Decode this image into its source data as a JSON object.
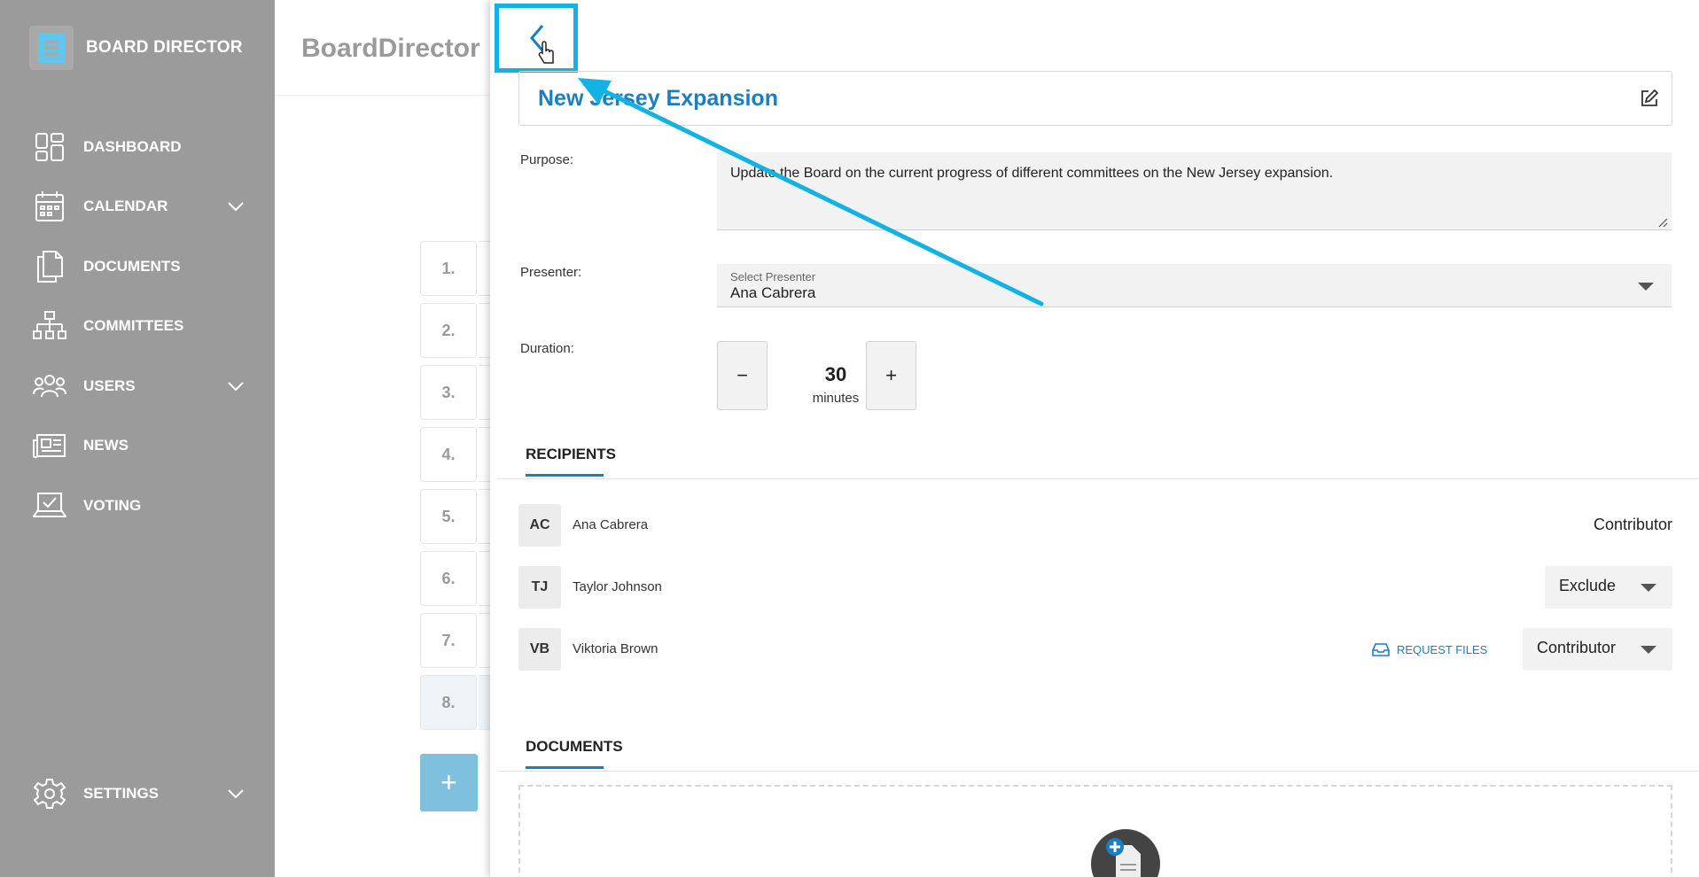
{
  "sidebar": {
    "brand": "BOARD DIRECTOR",
    "items": [
      {
        "label": "DASHBOARD",
        "icon": "dashboard-icon"
      },
      {
        "label": "CALENDAR",
        "icon": "calendar-icon"
      },
      {
        "label": "DOCUMENTS",
        "icon": "documents-icon"
      },
      {
        "label": "COMMITTEES",
        "icon": "org-chart-icon"
      },
      {
        "label": "USERS",
        "icon": "users-icon"
      },
      {
        "label": "NEWS",
        "icon": "newspaper-icon"
      },
      {
        "label": "VOTING",
        "icon": "voting-icon"
      },
      {
        "label": "SETTINGS",
        "icon": "gear-icon"
      }
    ]
  },
  "header": {
    "app_title": "BoardDirector"
  },
  "agenda": {
    "numbers": [
      "1.",
      "2.",
      "3.",
      "4.",
      "5.",
      "6.",
      "7.",
      "8."
    ],
    "add_label": "+"
  },
  "panel": {
    "title": "New Jersey Expansion",
    "purpose_label": "Purpose:",
    "purpose_text": "Update the Board on the current progress of different committees on the New Jersey expansion.",
    "presenter_label": "Presenter:",
    "presenter_hint": "Select Presenter",
    "presenter_value": "Ana Cabrera",
    "duration_label": "Duration:",
    "duration_minus": "−",
    "duration_plus": "+",
    "duration_value": "30",
    "duration_unit": "minutes",
    "recipients_heading": "RECIPIENTS",
    "recipients": [
      {
        "initials": "AC",
        "name": "Ana Cabrera",
        "role": "Contributor"
      },
      {
        "initials": "TJ",
        "name": "Taylor Johnson",
        "role": "Exclude"
      },
      {
        "initials": "VB",
        "name": "Viktoria Brown",
        "role": "Contributor",
        "action": "REQUEST FILES"
      }
    ],
    "documents_heading": "DOCUMENTS"
  },
  "colors": {
    "accent": "#1a7fc1",
    "highlight": "#12b3e3",
    "sidebar_bg": "#9b9b9b"
  }
}
